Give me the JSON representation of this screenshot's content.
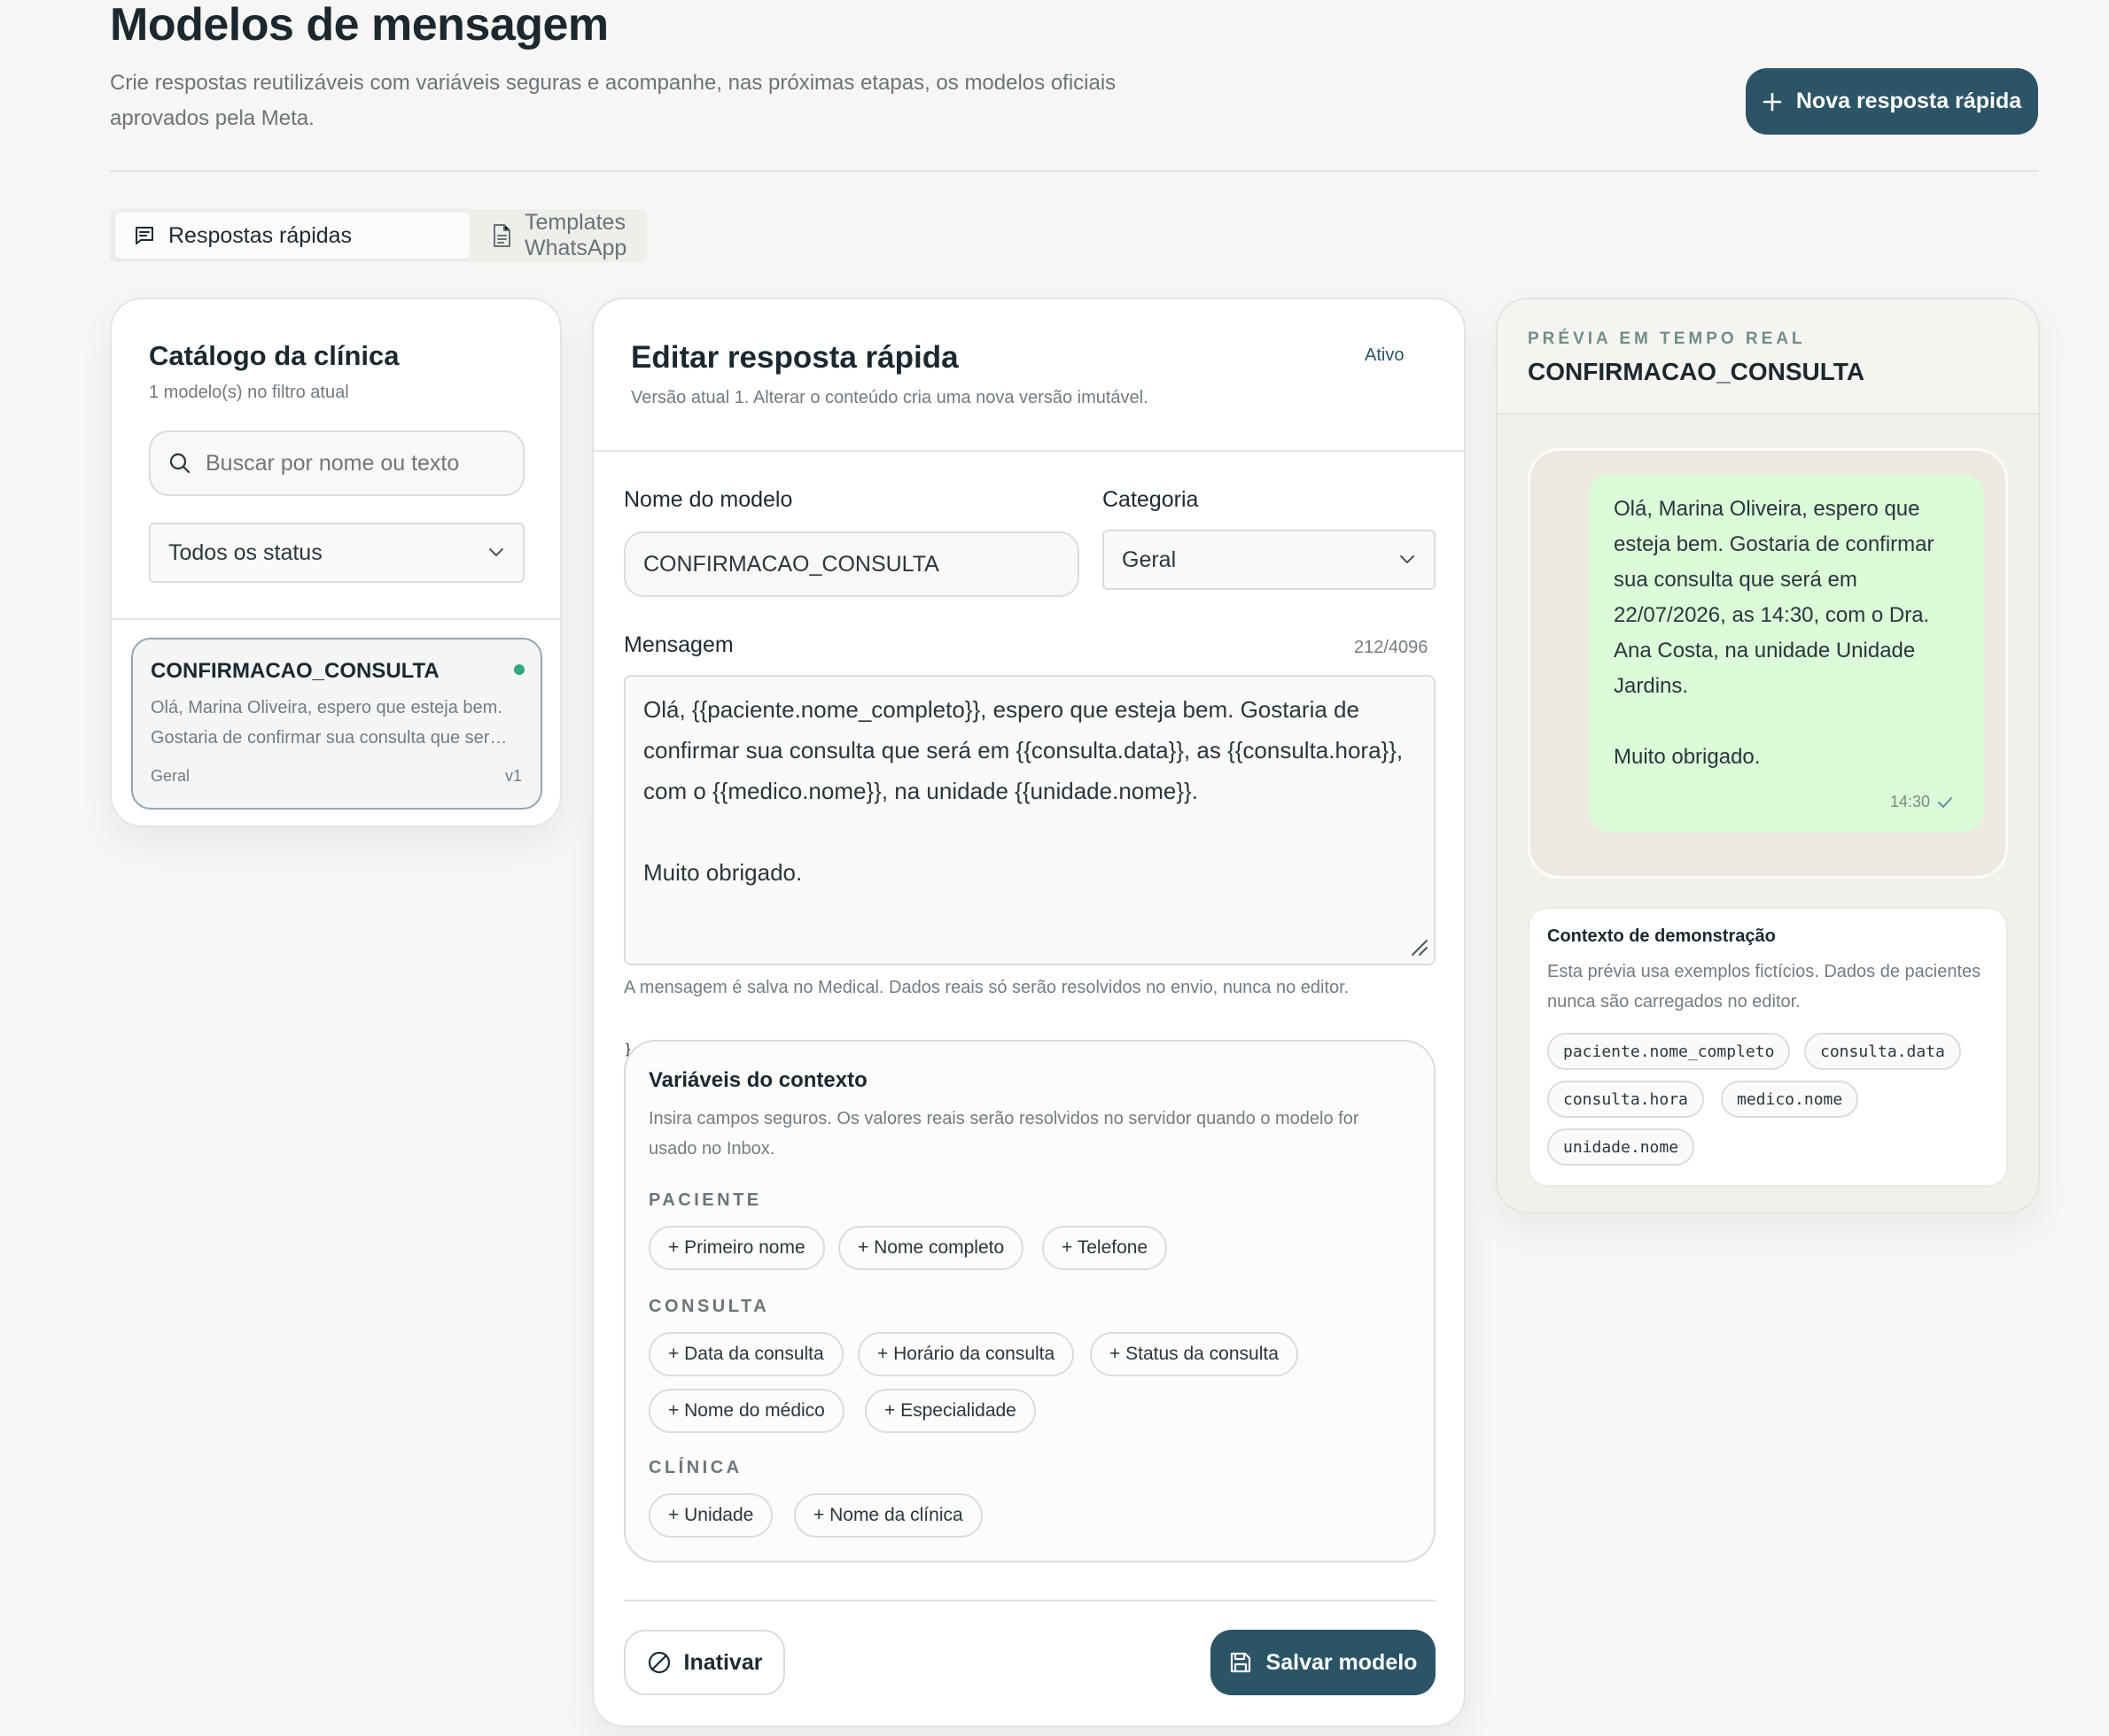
{
  "header": {
    "title": "Modelos de mensagem",
    "subtitle": "Crie respostas reutilizáveis com variáveis seguras e acompanhe, nas próximas etapas, os modelos oficiais aprovados pela Meta.",
    "new_button": "Nova resposta rápida"
  },
  "tabs": [
    {
      "label": "Respostas rápidas",
      "active": true
    },
    {
      "label": "Templates WhatsApp",
      "active": false
    }
  ],
  "catalog": {
    "title": "Catálogo da clínica",
    "count_text": "1 modelo(s) no filtro atual",
    "search_placeholder": "Buscar por nome ou texto",
    "status_filter": "Todos os status",
    "items": [
      {
        "name": "CONFIRMACAO_CONSULTA",
        "preview": "Olá, Marina Oliveira, espero que esteja bem. Gostaria de confirmar sua consulta que ser…",
        "category": "Geral",
        "version": "v1",
        "status_color": "#2fa97a"
      }
    ]
  },
  "editor": {
    "title": "Editar resposta rápida",
    "status": "Ativo",
    "version_note": "Versão atual 1. Alterar o conteúdo cria uma nova versão imutável.",
    "name_label": "Nome do modelo",
    "name_value": "CONFIRMACAO_CONSULTA",
    "category_label": "Categoria",
    "category_value": "Geral",
    "message_label": "Mensagem",
    "char_count": "212/4096",
    "message_value": "Olá, {{paciente.nome_completo}}, espero que esteja bem. Gostaria de confirmar sua consulta que será em {{consulta.data}}, as {{consulta.hora}}, com o {{medico.nome}}, na unidade {{unidade.nome}}.\n\nMuito obrigado.",
    "message_hint": "A mensagem é salva no Medical. Dados reais só serão resolvidos no envio, nunca no editor.",
    "variables": {
      "title": "Variáveis do contexto",
      "description": "Insira campos seguros. Os valores reais serão resolvidos no servidor quando o modelo for usado no Inbox.",
      "groups": [
        {
          "label": "PACIENTE",
          "chips": [
            "+ Primeiro nome",
            "+ Nome completo",
            "+ Telefone"
          ]
        },
        {
          "label": "CONSULTA",
          "chips": [
            "+ Data da consulta",
            "+ Horário da consulta",
            "+ Status da consulta",
            "+ Nome do médico",
            "+ Especialidade"
          ]
        },
        {
          "label": "CLÍNICA",
          "chips": [
            "+ Unidade",
            "+ Nome da clínica"
          ]
        }
      ]
    },
    "deactivate_button": "Inativar",
    "save_button": "Salvar modelo"
  },
  "preview": {
    "eyebrow": "PRÉVIA EM TEMPO REAL",
    "name": "CONFIRMACAO_CONSULTA",
    "bubble_text": "Olá, Marina Oliveira, espero que esteja bem. Gostaria de confirmar sua consulta que será em 22/07/2026, as 14:30, com o Dra. Ana Costa, na unidade Unidade Jardins.\n\nMuito obrigado.",
    "bubble_time": "14:30",
    "context_title": "Contexto de demonstração",
    "context_text": "Esta prévia usa exemplos fictícios. Dados de pacientes nunca são carregados no editor.",
    "context_vars": [
      "paciente.nome_completo",
      "consulta.data",
      "consulta.hora",
      "medico.nome",
      "unidade.nome"
    ]
  },
  "colors": {
    "primary": "#2b5466",
    "active_dot": "#2fa97a",
    "bubble": "#dbfad7"
  }
}
